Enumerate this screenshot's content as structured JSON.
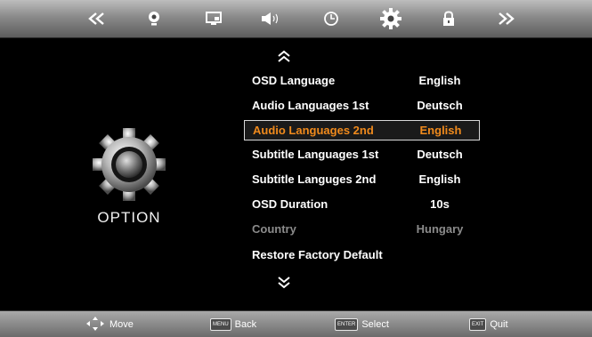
{
  "top_bar": {
    "icons": [
      {
        "name": "prev-arrows-icon",
        "glyph": "«"
      },
      {
        "name": "picture-icon"
      },
      {
        "name": "screen-icon"
      },
      {
        "name": "sound-icon"
      },
      {
        "name": "clock-icon"
      },
      {
        "name": "settings-gear-icon",
        "active": true
      },
      {
        "name": "lock-icon"
      },
      {
        "name": "next-arrows-icon",
        "glyph": "»"
      }
    ]
  },
  "sidebar": {
    "title": "OPTION"
  },
  "menu": {
    "items": [
      {
        "label": "OSD Language",
        "value": "English",
        "state": "normal"
      },
      {
        "label": "Audio Languages 1st",
        "value": "Deutsch",
        "state": "normal"
      },
      {
        "label": "Audio Languages 2nd",
        "value": "English",
        "state": "selected"
      },
      {
        "label": "Subtitle Languages 1st",
        "value": "Deutsch",
        "state": "normal"
      },
      {
        "label": "Subtitle Languges 2nd",
        "value": "English",
        "state": "normal"
      },
      {
        "label": "OSD Duration",
        "value": "10s",
        "state": "normal"
      },
      {
        "label": "Country",
        "value": "Hungary",
        "state": "disabled"
      },
      {
        "label": "Restore Factory Default",
        "value": "",
        "state": "normal"
      }
    ]
  },
  "bottom_bar": {
    "move": "Move",
    "menu_key": "MENU",
    "back": "Back",
    "enter_key": "ENTER",
    "select": "Select",
    "exit_key": "EXIT",
    "quit": "Quit"
  },
  "colors": {
    "selected_text": "#f08a1c",
    "disabled_text": "#8b8b8b"
  }
}
